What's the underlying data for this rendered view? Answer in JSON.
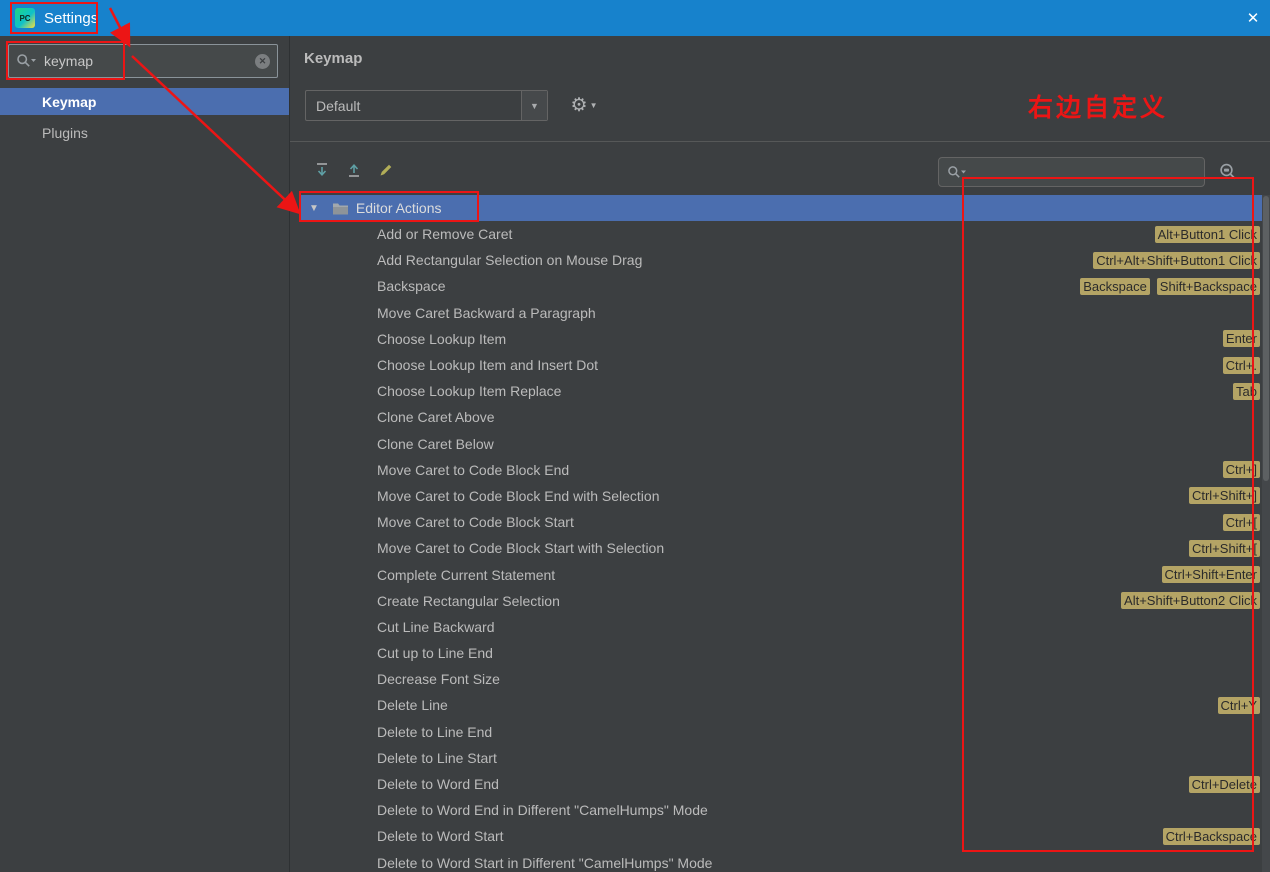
{
  "window": {
    "title": "Settings",
    "close_glyph": "✕",
    "app_icon_text": "PC"
  },
  "colors": {
    "titlebar": "#1782cc",
    "background": "#3c3f41",
    "selection": "#4b6eaf",
    "badge_bg": "#b4a465",
    "annotation_red": "#ec1515"
  },
  "sidebar": {
    "search": {
      "value": "keymap",
      "placeholder": ""
    },
    "items": [
      {
        "label": "Keymap",
        "selected": true
      },
      {
        "label": "Plugins",
        "selected": false
      }
    ]
  },
  "main": {
    "title": "Keymap",
    "scheme": {
      "selected": "Default"
    },
    "toolbar": {
      "buttons": [
        "expand-all",
        "collapse-all",
        "edit-shortcut"
      ]
    },
    "search": {
      "value": "",
      "placeholder": ""
    },
    "tree": {
      "group": {
        "label": "Editor Actions",
        "expanded": true,
        "selected": true,
        "expander_glyph": "▼"
      },
      "rows": [
        {
          "label": "Add or Remove Caret",
          "shortcuts": [
            "Alt+Button1 Click"
          ]
        },
        {
          "label": "Add Rectangular Selection on Mouse Drag",
          "shortcuts": [
            "Ctrl+Alt+Shift+Button1 Click"
          ]
        },
        {
          "label": "Backspace",
          "shortcuts": [
            "Backspace",
            "Shift+Backspace"
          ]
        },
        {
          "label": "Move Caret Backward a Paragraph",
          "shortcuts": []
        },
        {
          "label": "Choose Lookup Item",
          "shortcuts": [
            "Enter"
          ]
        },
        {
          "label": "Choose Lookup Item and Insert Dot",
          "shortcuts": [
            "Ctrl+."
          ]
        },
        {
          "label": "Choose Lookup Item Replace",
          "shortcuts": [
            "Tab"
          ]
        },
        {
          "label": "Clone Caret Above",
          "shortcuts": []
        },
        {
          "label": "Clone Caret Below",
          "shortcuts": []
        },
        {
          "label": "Move Caret to Code Block End",
          "shortcuts": [
            "Ctrl+]"
          ]
        },
        {
          "label": "Move Caret to Code Block End with Selection",
          "shortcuts": [
            "Ctrl+Shift+]"
          ]
        },
        {
          "label": "Move Caret to Code Block Start",
          "shortcuts": [
            "Ctrl+["
          ]
        },
        {
          "label": "Move Caret to Code Block Start with Selection",
          "shortcuts": [
            "Ctrl+Shift+["
          ]
        },
        {
          "label": "Complete Current Statement",
          "shortcuts": [
            "Ctrl+Shift+Enter"
          ]
        },
        {
          "label": "Create Rectangular Selection",
          "shortcuts": [
            "Alt+Shift+Button2 Click"
          ]
        },
        {
          "label": "Cut Line Backward",
          "shortcuts": []
        },
        {
          "label": "Cut up to Line End",
          "shortcuts": []
        },
        {
          "label": "Decrease Font Size",
          "shortcuts": []
        },
        {
          "label": "Delete Line",
          "shortcuts": [
            "Ctrl+Y"
          ]
        },
        {
          "label": "Delete to Line End",
          "shortcuts": []
        },
        {
          "label": "Delete to Line Start",
          "shortcuts": []
        },
        {
          "label": "Delete to Word End",
          "shortcuts": [
            "Ctrl+Delete"
          ]
        },
        {
          "label": "Delete to Word End in Different \"CamelHumps\" Mode",
          "shortcuts": []
        },
        {
          "label": "Delete to Word Start",
          "shortcuts": [
            "Ctrl+Backspace"
          ]
        },
        {
          "label": "Delete to Word Start in Different \"CamelHumps\" Mode",
          "shortcuts": []
        }
      ]
    }
  },
  "annotations": {
    "note_text": "右边自定义"
  }
}
